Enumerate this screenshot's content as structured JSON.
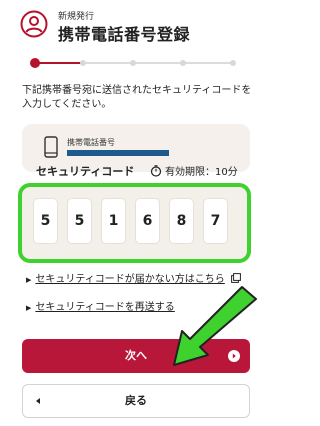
{
  "header": {
    "subtitle": "新規発行",
    "title": "携帯電話番号登録"
  },
  "stepper": {
    "total_steps": 5,
    "current_step": 1
  },
  "instruction": "下記携帯番号宛に送信されたセキュリティコードを入力してください。",
  "phone_card": {
    "label": "携帯電話番号",
    "value": ""
  },
  "security_code": {
    "label": "セキュリティコード",
    "expiry_text": "有効期限：10分",
    "digits": [
      "5",
      "5",
      "1",
      "6",
      "8",
      "7"
    ],
    "highlight_color": "#3fd22f"
  },
  "links": {
    "not_received": "セキュリティコードが届かない方はこちら",
    "resend": "セキュリティコードを再送する"
  },
  "buttons": {
    "next": "次へ",
    "back": "戻る"
  },
  "colors": {
    "brand": "#b8173a",
    "annotation_arrow": "#3fd22f"
  }
}
